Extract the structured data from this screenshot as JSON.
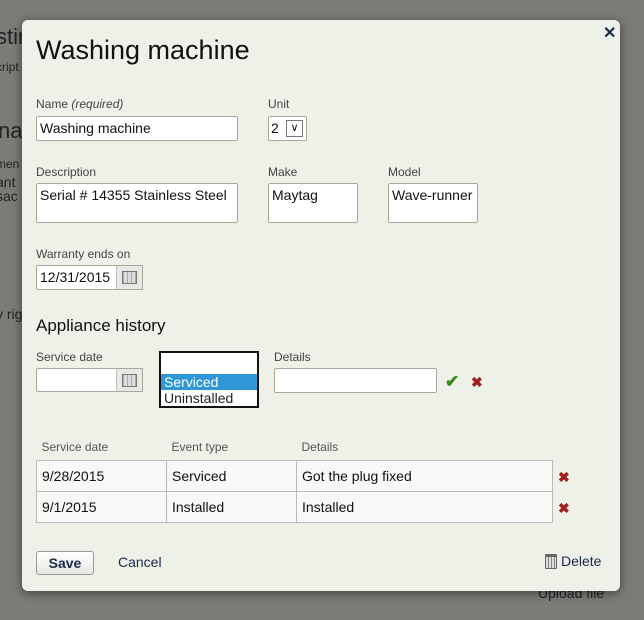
{
  "background": {
    "fragments": [
      "stin",
      "cript",
      "na",
      "men",
      "ant",
      "sac",
      "y rig",
      "Upload file"
    ]
  },
  "dialog": {
    "title": "Washing machine",
    "close_icon": "close-icon",
    "name_label": "Name",
    "name_required": "(required)",
    "name_value": "Washing machine",
    "unit_label": "Unit",
    "unit_value": "2",
    "description_label": "Description",
    "description_value": "Serial # 14355 Stainless Steel",
    "make_label": "Make",
    "make_value": "Maytag",
    "model_label": "Model",
    "model_value": "Wave-runner",
    "warranty_label": "Warranty ends on",
    "warranty_value": "12/31/2015",
    "history_title": "Appliance history",
    "service_date_label": "Service date",
    "service_date_value": "",
    "event_options": [
      "",
      "Serviced",
      "Uninstalled"
    ],
    "event_selected": "Serviced",
    "details_label": "Details",
    "details_value": "",
    "table": {
      "headers": [
        "Service date",
        "Event type",
        "Details"
      ],
      "rows": [
        [
          "9/28/2015",
          "Serviced",
          "Got the plug fixed"
        ],
        [
          "9/1/2015",
          "Installed",
          "Installed"
        ]
      ]
    },
    "save_label": "Save",
    "cancel_label": "Cancel",
    "delete_label": "Delete"
  }
}
